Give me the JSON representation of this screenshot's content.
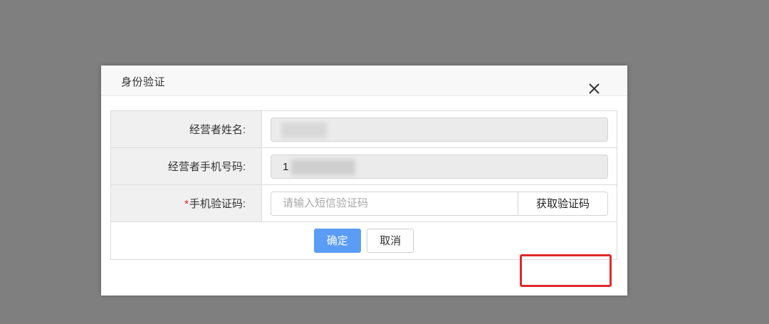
{
  "dialog": {
    "title": "身份验证",
    "close_icon": "close-icon"
  },
  "form": {
    "operator_name": {
      "label": "经营者姓名:",
      "value": ""
    },
    "operator_phone": {
      "label": "经营者手机号码:",
      "value_prefix": "1"
    },
    "sms_code": {
      "required_mark": "*",
      "label": "手机验证码:",
      "placeholder": "请输入短信验证码",
      "get_code_label": "获取验证码"
    }
  },
  "actions": {
    "confirm_label": "确定",
    "cancel_label": "取消"
  },
  "colors": {
    "primary": "#5b9cf6",
    "required": "#e02020",
    "highlight": "#e0282a",
    "overlay": "#7f7f7f"
  }
}
